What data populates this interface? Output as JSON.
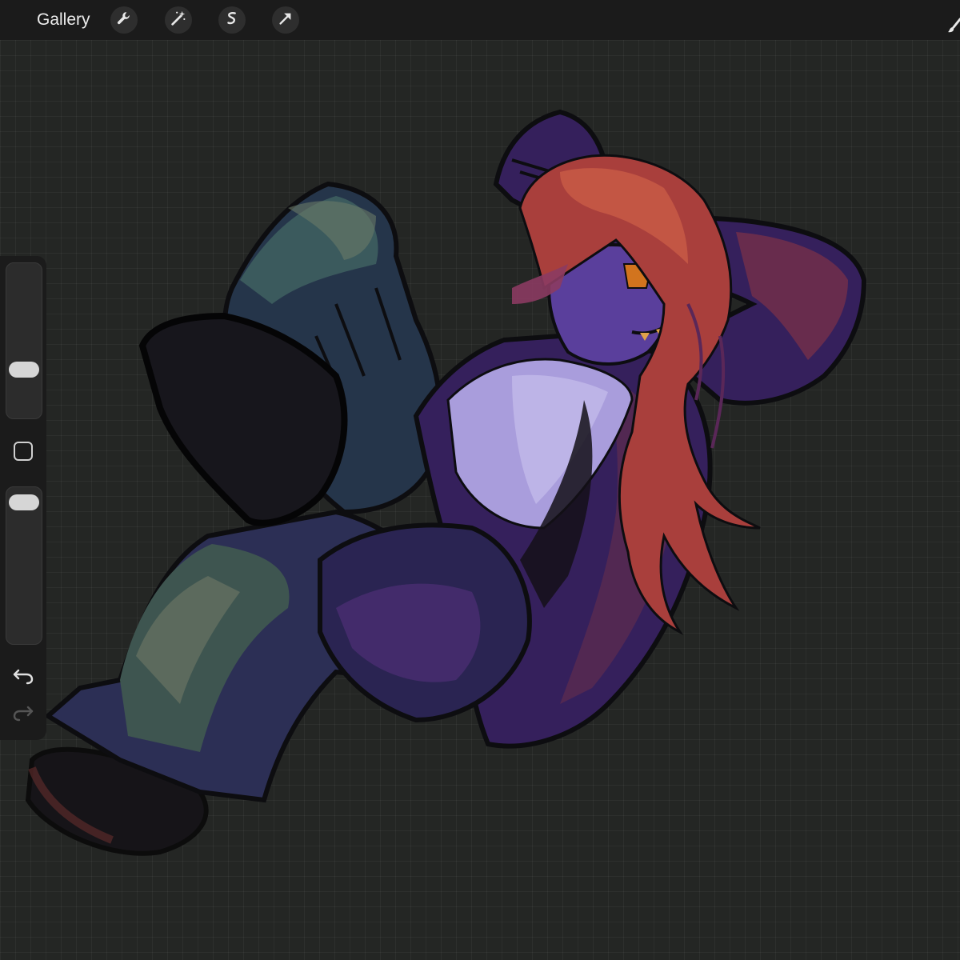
{
  "toolbar": {
    "gallery_label": "Gallery",
    "tools": [
      {
        "name": "actions",
        "icon": "wrench-icon"
      },
      {
        "name": "adjustments",
        "icon": "magic-wand-icon"
      },
      {
        "name": "selection",
        "icon": "selection-s-icon"
      },
      {
        "name": "transform",
        "icon": "arrow-cursor-icon"
      }
    ],
    "right_tool_icon": "brush-icon"
  },
  "sidebar": {
    "brush_size_level": 0.72,
    "brush_opacity_level": 0.02,
    "modify_button_icon": "square-icon",
    "undo_icon": "undo-arrow-icon",
    "redo_icon": "redo-arrow-icon"
  },
  "canvas": {
    "background_color": "#242624",
    "grid_visible": true
  },
  "colors": {
    "toolbar_bg": "#1b1b1b",
    "hair": "#b8463a",
    "jacket": "#3a2463",
    "pants": "#243a45",
    "shirt": "#a89ad8",
    "skin": "#5b3f9a"
  }
}
